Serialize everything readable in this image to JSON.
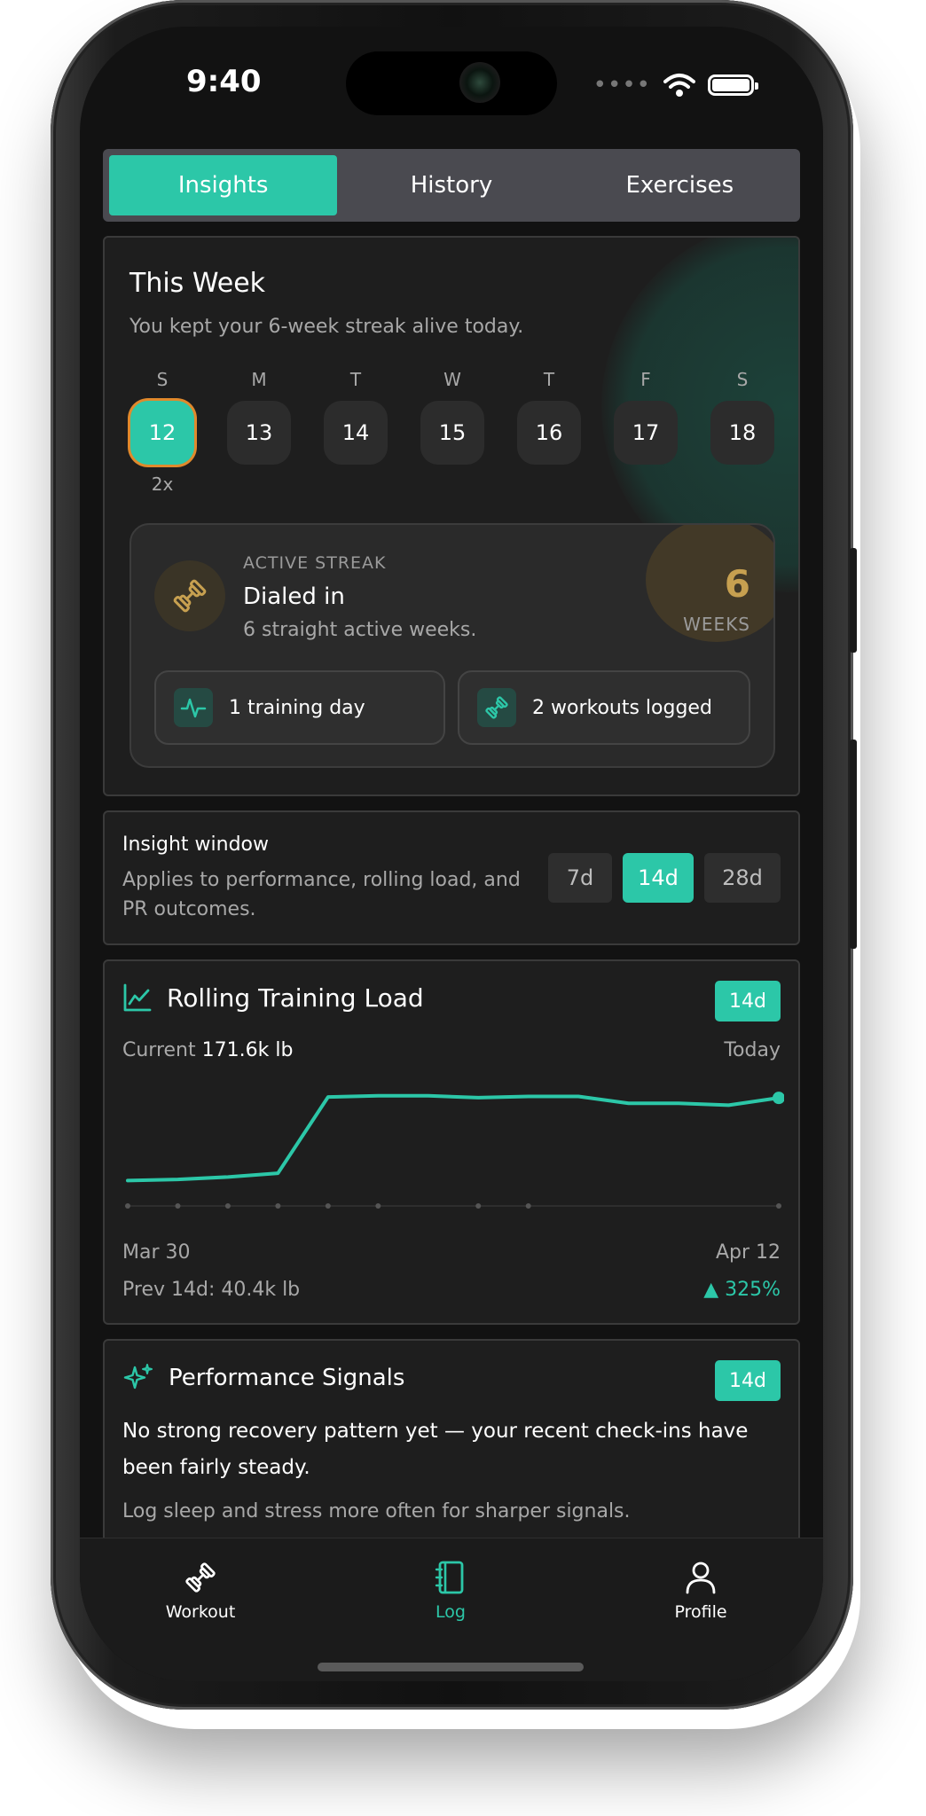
{
  "status_bar": {
    "time": "9:40",
    "signal": "••••"
  },
  "tabs": [
    {
      "label": "Insights",
      "active": true
    },
    {
      "label": "History",
      "active": false
    },
    {
      "label": "Exercises",
      "active": false
    }
  ],
  "this_week": {
    "title": "This Week",
    "subtitle": "You kept your 6-week streak alive today.",
    "days": [
      {
        "letter": "S",
        "date": "12",
        "selected": true,
        "count": "2x"
      },
      {
        "letter": "M",
        "date": "13",
        "selected": false,
        "count": ""
      },
      {
        "letter": "T",
        "date": "14",
        "selected": false,
        "count": ""
      },
      {
        "letter": "W",
        "date": "15",
        "selected": false,
        "count": ""
      },
      {
        "letter": "T",
        "date": "16",
        "selected": false,
        "count": ""
      },
      {
        "letter": "F",
        "date": "17",
        "selected": false,
        "count": ""
      },
      {
        "letter": "S",
        "date": "18",
        "selected": false,
        "count": ""
      }
    ],
    "streak": {
      "kicker": "ACTIVE STREAK",
      "title": "Dialed in",
      "subtitle": "6 straight active weeks.",
      "number": "6",
      "unit": "WEEKS",
      "chip_training": "1 training day",
      "chip_workouts": "2 workouts logged"
    }
  },
  "insight_window": {
    "title": "Insight window",
    "description": "Applies to performance, rolling load, and PR outcomes.",
    "options": [
      {
        "label": "7d",
        "active": false
      },
      {
        "label": "14d",
        "active": true
      },
      {
        "label": "28d",
        "active": false
      }
    ]
  },
  "rolling_load": {
    "title": "Rolling Training Load",
    "badge": "14d",
    "current_label": "Current",
    "current_value": "171.6k lb",
    "today_label": "Today",
    "start_label": "Mar 30",
    "end_label": "Apr 12",
    "prev": "Prev 14d: 40.4k lb",
    "change": "▲ 325%"
  },
  "chart_data": {
    "type": "line",
    "title": "Rolling Training Load",
    "x": [
      "Mar 30",
      "Mar 31",
      "Apr 1",
      "Apr 2",
      "Apr 3",
      "Apr 4",
      "Apr 5",
      "Apr 6",
      "Apr 7",
      "Apr 8",
      "Apr 9",
      "Apr 10",
      "Apr 11",
      "Apr 12"
    ],
    "series": [
      {
        "values": [
          40.4,
          42,
          46,
          52,
          173,
          175,
          175,
          172,
          174,
          174,
          163,
          163,
          160,
          171.6
        ]
      }
    ],
    "workout_markers": [
      0,
      1,
      2,
      3,
      4,
      5,
      7,
      8,
      13
    ],
    "ylim": [
      0,
      200
    ],
    "xlabel": "",
    "ylabel": "",
    "line_color": "#2cc7a8",
    "grid": false
  },
  "performance_signals": {
    "title": "Performance Signals",
    "badge": "14d",
    "body": "No strong recovery pattern yet — your recent check-ins have been fairly steady.",
    "footnote": "Log sleep and stress more often for sharper signals."
  },
  "bottom_nav": [
    {
      "label": "Workout",
      "icon": "dumbbell-icon",
      "active": false
    },
    {
      "label": "Log",
      "icon": "notebook-icon",
      "active": true
    },
    {
      "label": "Profile",
      "icon": "person-icon",
      "active": false
    }
  ],
  "colors": {
    "accent": "#2cc7a8",
    "streak_gold": "#c7a050",
    "selected_outline": "#e0892c",
    "background": "#121212",
    "card": "#1e1e1e"
  }
}
